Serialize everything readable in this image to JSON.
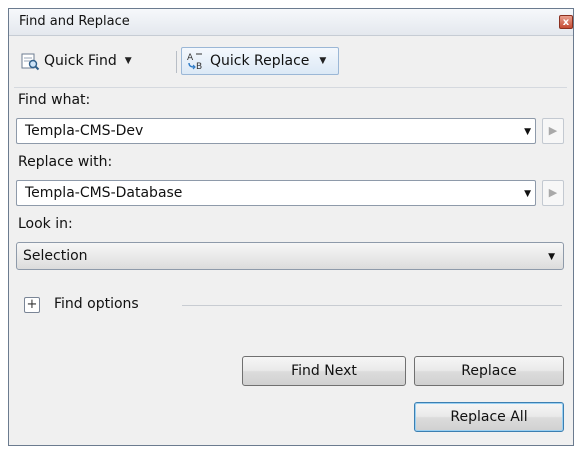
{
  "window": {
    "title": "Find and Replace",
    "close_glyph": "x"
  },
  "toolbar": {
    "quick_find": {
      "label": "Quick Find",
      "icon": "binoculars-icon"
    },
    "quick_replace": {
      "label": "Quick Replace",
      "icon": "replace-icon"
    }
  },
  "find": {
    "label": "Find what:",
    "value": "Templa-CMS-Dev"
  },
  "replace": {
    "label": "Replace with:",
    "value": "Templa-CMS-Database"
  },
  "look_in": {
    "label": "Look in:",
    "value": "Selection"
  },
  "find_options": {
    "label": "Find options",
    "expander": "+"
  },
  "buttons": {
    "find_next": "Find Next",
    "replace": "Replace",
    "replace_all": "Replace All"
  },
  "colors": {
    "accent": "#3c7fb1",
    "selected_tool": "#dce9f6"
  }
}
